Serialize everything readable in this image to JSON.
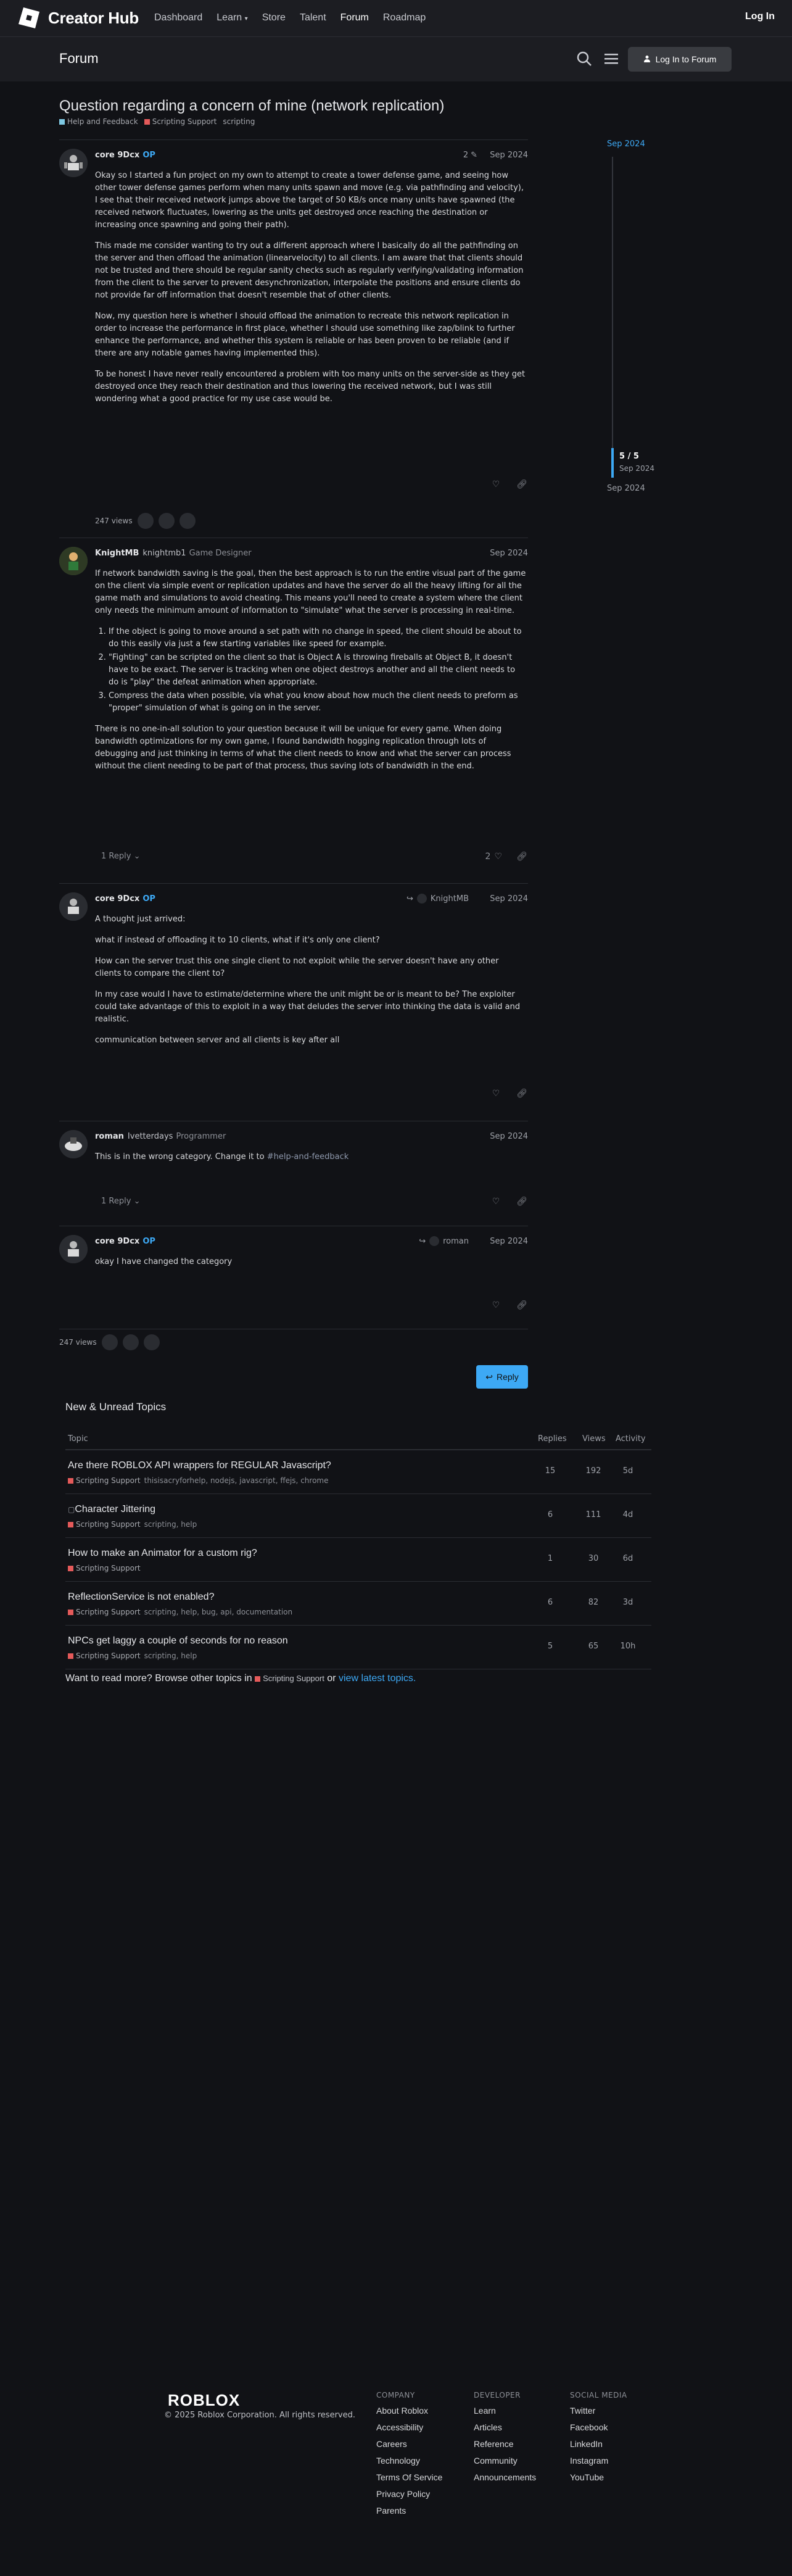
{
  "nav": {
    "brand": "Creator Hub",
    "links": [
      "Dashboard",
      "Learn",
      "Store",
      "Talent",
      "Forum",
      "Roadmap"
    ],
    "login": "Log In"
  },
  "forum_header": {
    "title": "Forum",
    "login_button": "Log In to Forum"
  },
  "topic": {
    "title": "Question regarding a concern of mine (network replication)",
    "categories": [
      {
        "name": "Help and Feedback",
        "color": "#7ec8e3"
      },
      {
        "name": "Scripting Support",
        "color": "#e45a5a"
      }
    ],
    "tag": "scripting"
  },
  "timeline": {
    "start": "Sep 2024",
    "position": "5 / 5",
    "position_date": "Sep 2024",
    "end": "Sep 2024"
  },
  "posts": [
    {
      "username": "core 9Dcx",
      "op": "OP",
      "date": "Sep 2024",
      "edits": "2",
      "paragraphs": [
        "Okay so I started a fun project on my own to attempt to create a tower defense game, and seeing how other tower defense games perform when many units spawn and move (e.g. via pathfinding and velocity), I see that their received network jumps above the target of 50 KB/s once many units have spawned (the received network fluctuates, lowering as the units get destroyed once reaching the destination or increasing once spawning and going their path).",
        "This made me consider wanting to try out a different approach where I basically do all the pathfinding on the server and then offload the animation (linearvelocity) to all clients. I am aware that that clients should not be trusted and there should be regular sanity checks such as regularly verifying/validating information from the client to the server to prevent desynchronization, interpolate the positions and ensure clients do not provide far off information that doesn't resemble that of other clients.",
        "Now, my question here is whether I should offload the animation to recreate this network replication in order to increase the performance in first place, whether I should use something like zap/blink to further enhance the performance, and whether this system is reliable or has been proven to be reliable (and if there are any notable games having implemented this).",
        "To be honest I have never really encountered a problem with too many units on the server-side as they get destroyed once they reach their destination and thus lowering the received network, but I was still wondering what a good practice for my use case would be."
      ],
      "views": "247 views"
    },
    {
      "username": "KnightMB",
      "fullname": "knightmb1",
      "title": "Game Designer",
      "date": "Sep 2024",
      "intro": "If network bandwidth saving is the goal, then the best approach is to run the entire visual part of the game on the client via simple event or replication updates and have the server do all the heavy lifting for all the game math and simulations to avoid cheating. This means you'll need to create a system where the client only needs the minimum amount of information to \"simulate\" what the server is processing in real-time.",
      "list": [
        "If the object is going to move around a set path with no change in speed, the client should be about to do this easily via just a few starting variables like speed for example.",
        "\"Fighting\" can be scripted on the client so that is Object A is throwing fireballs at Object B, it doesn't have to be exact. The server is tracking when one object destroys another and all the client needs to do is \"play\" the defeat animation when appropriate.",
        "Compress the data when possible, via what you know about how much the client needs to preform as \"proper\" simulation of what is going on in the server."
      ],
      "outro": "There is no one-in-all solution to your question because it will be unique for every game. When doing bandwidth optimizations for my own game, I found bandwidth hogging replication through lots of debugging and just thinking in terms of what the client needs to know and what the server can process without the client needing to be part of that process, thus saving lots of bandwidth in the end.",
      "replies": "1 Reply",
      "likes": "2"
    },
    {
      "username": "core 9Dcx",
      "op": "OP",
      "date": "Sep 2024",
      "reply_to": "KnightMB",
      "paragraphs": [
        "A thought just arrived:",
        "what if instead of offloading it to 10 clients, what if it's only one client?",
        "How can the server trust this one single client to not exploit while the server doesn't have any other clients to compare the client to?",
        "In my case would I have to estimate/determine where the unit might be or is meant to be? The exploiter could take advantage of this to exploit in a way that deludes the server into thinking the data is valid and realistic.",
        "communication between server and all clients is key after all"
      ]
    },
    {
      "username": "roman",
      "fullname": "Ivetterdays",
      "title": "Programmer",
      "date": "Sep 2024",
      "text": "This is in the wrong category. Change it to",
      "link": "#help-and-feedback",
      "replies": "1 Reply"
    },
    {
      "username": "core 9Dcx",
      "op": "OP",
      "date": "Sep 2024",
      "reply_to": "roman",
      "text": "okay I have changed the category"
    }
  ],
  "bottom_views": "247 views",
  "reply_button": "Reply",
  "suggested": {
    "title": "New & Unread Topics",
    "headers": {
      "topic": "Topic",
      "replies": "Replies",
      "views": "Views",
      "activity": "Activity"
    },
    "rows": [
      {
        "title": "Are there ROBLOX API wrappers for REGULAR Javascript?",
        "category": "Scripting Support",
        "tags": "thisisacryforhelp, nodejs, javascript, ffejs, chrome",
        "replies": "15",
        "views": "192",
        "activity": "5d"
      },
      {
        "title": "Character Jittering",
        "category": "Scripting Support",
        "tags": "scripting, help",
        "replies": "6",
        "views": "111",
        "activity": "4d"
      },
      {
        "title": "How to make an Animator for a custom rig?",
        "category": "Scripting Support",
        "tags": "",
        "replies": "1",
        "views": "30",
        "activity": "6d"
      },
      {
        "title": "ReflectionService is not enabled?",
        "category": "Scripting Support",
        "tags": "scripting, help, bug, api, documentation",
        "replies": "6",
        "views": "82",
        "activity": "3d"
      },
      {
        "title": "NPCs get laggy a couple of seconds for no reason",
        "category": "Scripting Support",
        "tags": "scripting, help",
        "replies": "5",
        "views": "65",
        "activity": "10h"
      }
    ],
    "more_prefix": "Want to read more? Browse other topics in",
    "more_category": "Scripting Support",
    "more_or": "or",
    "more_link": "view latest topics."
  },
  "footer": {
    "logo": "ROBLOX",
    "copyright": "© 2025 Roblox Corporation. All rights reserved.",
    "company": {
      "heading": "COMPANY",
      "items": [
        "About Roblox",
        "Accessibility",
        "Careers",
        "Technology",
        "Terms Of Service",
        "Privacy Policy",
        "Parents"
      ]
    },
    "developer": {
      "heading": "DEVELOPER",
      "items": [
        "Learn",
        "Articles",
        "Reference",
        "Community",
        "Announcements"
      ]
    },
    "social": {
      "heading": "SOCIAL MEDIA",
      "items": [
        "Twitter",
        "Facebook",
        "LinkedIn",
        "Instagram",
        "YouTube"
      ]
    }
  }
}
